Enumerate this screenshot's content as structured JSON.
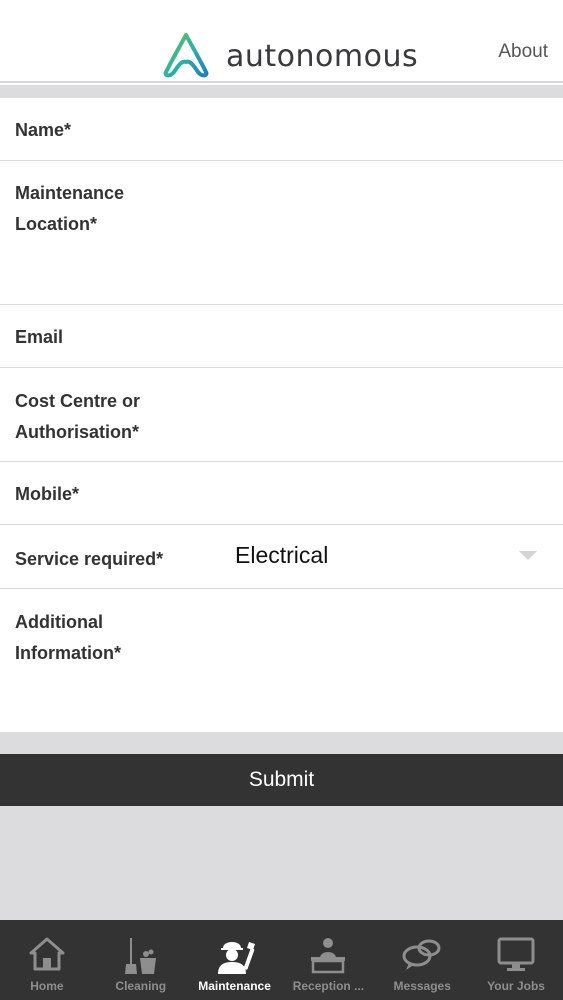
{
  "header": {
    "brand": "autonomous",
    "about_label": "About",
    "logo_icon": "autonomous-logo-icon",
    "brand_colors": [
      "#2bb3a4",
      "#1f7fb8"
    ]
  },
  "form": {
    "fields": [
      {
        "label": "Name*"
      },
      {
        "label": "Maintenance Location*"
      },
      {
        "label": "Email"
      },
      {
        "label": "Cost Centre or Authorisation*"
      },
      {
        "label": "Mobile*"
      },
      {
        "label": "Service required*",
        "value": "Electrical"
      },
      {
        "label": "Additional Information*"
      }
    ]
  },
  "submit_label": "Submit",
  "tabs": [
    {
      "label": "Home",
      "icon": "home-icon"
    },
    {
      "label": "Cleaning",
      "icon": "cleaning-icon"
    },
    {
      "label": "Maintenance",
      "icon": "maintenance-worker-icon",
      "active": true
    },
    {
      "label": "Reception ...",
      "icon": "reception-desk-icon"
    },
    {
      "label": "Messages",
      "icon": "messages-icon"
    },
    {
      "label": "Your Jobs",
      "icon": "monitor-icon"
    }
  ],
  "colors": {
    "tabbar_bg": "#333333",
    "submit_bg": "#333333",
    "page_gap": "#dcdcdf"
  }
}
